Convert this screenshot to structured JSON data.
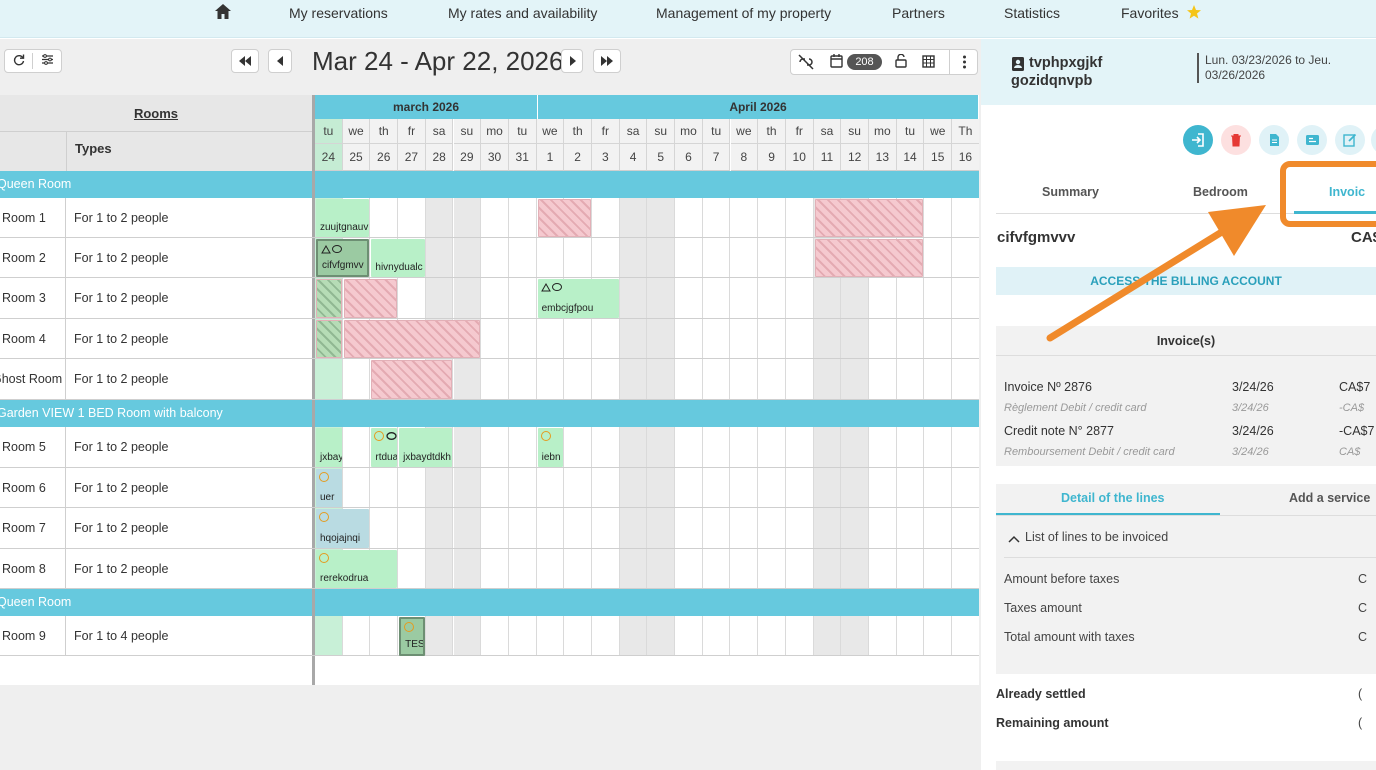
{
  "nav": {
    "items": [
      "My reservations",
      "My rates and availability",
      "Management of my property",
      "Partners",
      "Statistics",
      "Favorites"
    ]
  },
  "toolbar": {
    "date_range": "Mar 24 - Apr 22, 2026",
    "count_badge": "208"
  },
  "grid": {
    "rooms_header": "Rooms",
    "types_header": "Types",
    "months": [
      "march 2026",
      "April 2026"
    ],
    "day_names": [
      "tu",
      "we",
      "th",
      "fr",
      "sa",
      "su",
      "mo",
      "tu",
      "we",
      "th",
      "fr",
      "sa",
      "su",
      "mo",
      "tu",
      "we",
      "th",
      "fr",
      "sa",
      "su",
      "mo",
      "tu",
      "we",
      "Th"
    ],
    "day_numbers": [
      "24",
      "25",
      "26",
      "27",
      "28",
      "29",
      "30",
      "31",
      "1",
      "2",
      "3",
      "4",
      "5",
      "6",
      "7",
      "8",
      "9",
      "10",
      "11",
      "12",
      "13",
      "14",
      "15",
      "16"
    ],
    "categories": [
      "Queen Room",
      "Garden VIEW 1 BED Room with balcony",
      "Queen Room"
    ],
    "rooms": [
      {
        "name": "Room 1",
        "type": "For 1 to 2 people"
      },
      {
        "name": "Room 2",
        "type": "For 1 to 2 people"
      },
      {
        "name": "Room 3",
        "type": "For 1 to 2 people"
      },
      {
        "name": "Room 4",
        "type": "For 1 to 2 people"
      },
      {
        "name": "Ghost Room",
        "type": "For 1 to 2 people"
      },
      {
        "name": "Room 5",
        "type": "For 1 to 2 people"
      },
      {
        "name": "Room 6",
        "type": "For 1 to 2 people"
      },
      {
        "name": "Room 7",
        "type": "For 1 to 2 people"
      },
      {
        "name": "Room 8",
        "type": "For 1 to 2 people"
      },
      {
        "name": "Room 9",
        "type": "For 1 to 4 people"
      }
    ],
    "reservations": [
      "zuujtgnauv",
      "cifvfgmvv",
      "hivnydualc",
      "embcjgfpou",
      "jxbay",
      "rtdua",
      "jxbaydtdkh",
      "iebn",
      "uer",
      "hqojajnqi",
      "rerekodrua",
      "TES"
    ]
  },
  "panel": {
    "guest_name": "tvphpxgjkf gozidqnvpb",
    "dates": "Lun. 03/23/2026 to Jeu. 03/26/2026",
    "tabs": [
      "Summary",
      "Bedroom",
      "Invoic"
    ],
    "account_name": "cifvfgmvvv",
    "currency": "CA$",
    "billing_button": "ACCESS THE BILLING ACCOUNT",
    "invoices_title": "Invoice(s)",
    "invoices": [
      {
        "label": "Invoice Nº 2876",
        "date": "3/24/26",
        "amount": "CA$7",
        "sub": false
      },
      {
        "label": "Règlement Debit / credit card",
        "date": "3/24/26",
        "amount": "-CA$",
        "sub": true
      },
      {
        "label": "Credit note N° 2877",
        "date": "3/24/26",
        "amount": "-CA$7",
        "sub": false
      },
      {
        "label": "Remboursement Debit / credit card",
        "date": "3/24/26",
        "amount": "CA$",
        "sub": true
      }
    ],
    "detail_tabs": [
      "Detail of the lines",
      "Add a service"
    ],
    "list_toggle": "List of lines to be invoiced",
    "totals": [
      {
        "label": "Amount before taxes",
        "value": "C"
      },
      {
        "label": "Taxes amount",
        "value": "C"
      },
      {
        "label": "Total amount with taxes",
        "value": "C"
      }
    ],
    "settled_label": "Already settled",
    "settled_value": "(",
    "remaining_label": "Remaining amount",
    "remaining_value": "("
  },
  "colors": {
    "accent": "#3fb6cf",
    "header_bg": "#66c9de",
    "callout": "#f08a2b"
  }
}
